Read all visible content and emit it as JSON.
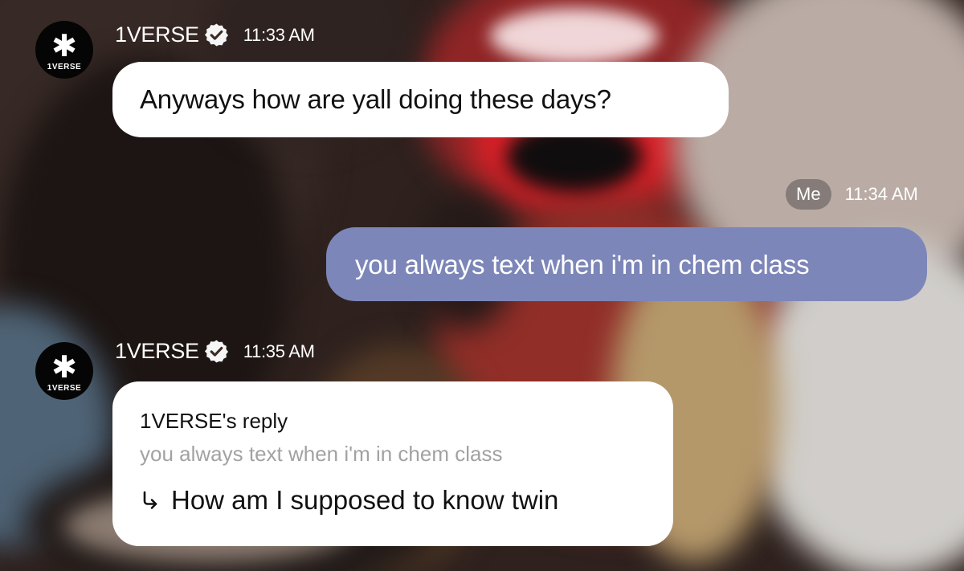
{
  "messages": [
    {
      "sender": "1VERSE",
      "time": "11:33 AM",
      "text": "Anyways how are yall doing these days?"
    },
    {
      "sender_label": "Me",
      "time": "11:34 AM",
      "text": "you always text when i'm in chem class"
    },
    {
      "sender": "1VERSE",
      "time": "11:35 AM",
      "reply_title": "1VERSE's reply",
      "reply_quote": "you always text when i'm in chem class",
      "reply_text": "How am I supposed to know twin"
    }
  ],
  "avatar": {
    "label": "1VERSE",
    "icon": "asterisk-icon"
  },
  "icons": {
    "verified": "verified-check-icon",
    "reply": "reply-arrow-icon"
  },
  "colors": {
    "incoming_bubble": "#ffffff",
    "outgoing_bubble": "#7d86b8",
    "me_pill": "#706868",
    "text_primary": "#111111",
    "text_secondary": "#a2a2a2"
  }
}
